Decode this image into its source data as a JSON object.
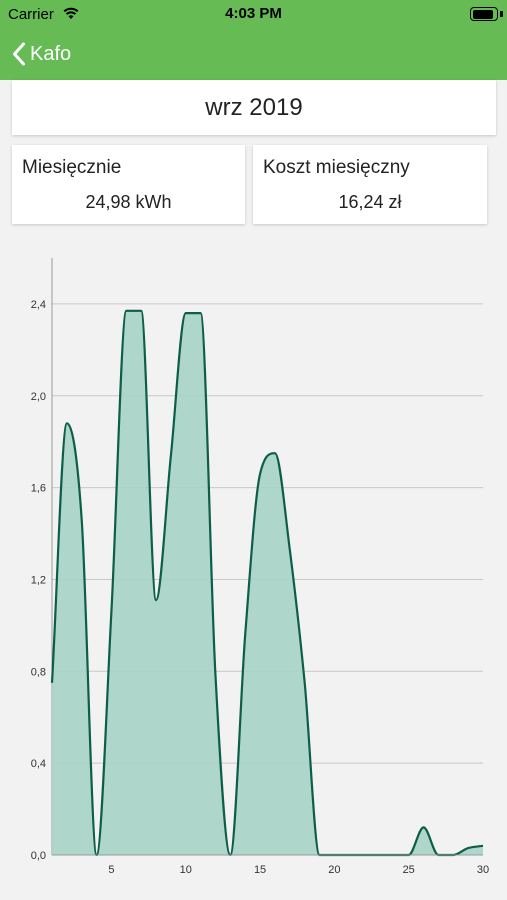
{
  "status_bar": {
    "carrier": "Carrier",
    "time": "4:03 PM",
    "battery_level": 0.9
  },
  "nav": {
    "back_label": "Kafo"
  },
  "period": {
    "label": "wrz 2019"
  },
  "stats": {
    "monthly_label": "Miesięcznie",
    "monthly_value": "24,98 kWh",
    "cost_label": "Koszt miesięczny",
    "cost_value": "16,24 zł"
  },
  "colors": {
    "header": "#66bb55",
    "line": "#0d5e48",
    "fill": "#a7d3c6",
    "grid": "#c8c8c8"
  },
  "icons": {
    "back": "chevron-left-icon",
    "wifi": "wifi-icon",
    "battery": "battery-icon"
  },
  "chart_data": {
    "type": "area",
    "x": [
      1,
      2,
      3,
      4,
      5,
      6,
      7,
      8,
      9,
      10,
      11,
      12,
      13,
      14,
      15,
      16,
      17,
      18,
      19,
      20,
      21,
      22,
      23,
      24,
      25,
      26,
      27,
      28,
      29,
      30
    ],
    "values": [
      0.75,
      1.88,
      1.46,
      0.0,
      1.06,
      2.37,
      2.37,
      1.11,
      1.74,
      2.36,
      2.36,
      0.78,
      0.0,
      0.96,
      1.66,
      1.75,
      1.33,
      0.75,
      0.0,
      0.0,
      0.0,
      0.0,
      0.0,
      0.0,
      0.0,
      0.12,
      0.0,
      0.0,
      0.03,
      0.04
    ],
    "xlim": [
      1,
      30
    ],
    "ylim": [
      0,
      2.6
    ],
    "y_ticks": [
      "0,0",
      "0,4",
      "0,8",
      "1,2",
      "1,6",
      "2,0",
      "2,4"
    ],
    "y_tick_values": [
      0,
      0.4,
      0.8,
      1.2,
      1.6,
      2.0,
      2.4
    ],
    "x_ticks": [
      "5",
      "10",
      "15",
      "20",
      "25",
      "30"
    ],
    "x_tick_values": [
      5,
      10,
      15,
      20,
      25,
      30
    ],
    "grid": "horizontal"
  }
}
